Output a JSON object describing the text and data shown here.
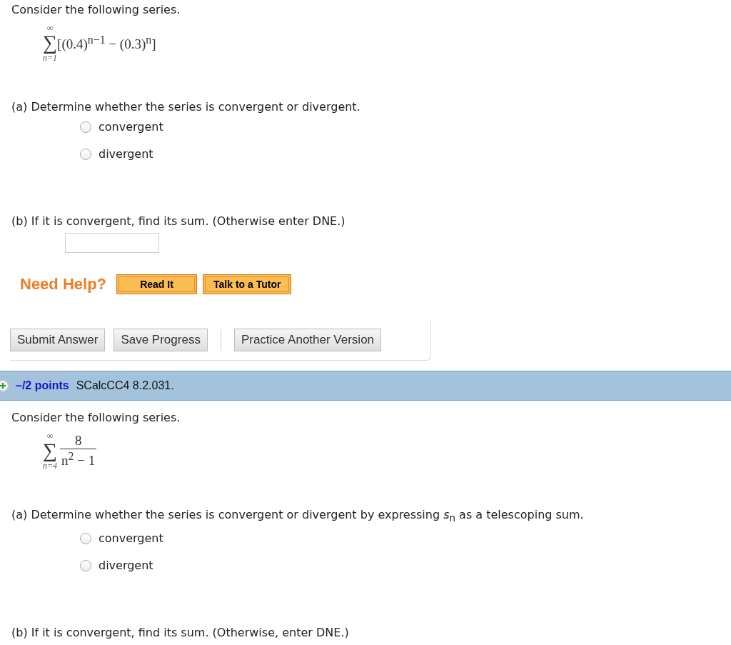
{
  "questions": [
    {
      "intro": "Consider the following series.",
      "formula": {
        "kind": "bracket",
        "upper": "∞",
        "sigma": "∑",
        "lower": "n=1",
        "body": "[(0.4)$^{n−1}$ − (0.3)$^{n}$]"
      },
      "part_a": {
        "prompt": "(a) Determine whether the series is convergent or divergent.",
        "options": [
          {
            "label": "convergent",
            "selected": false
          },
          {
            "label": "divergent",
            "selected": false
          }
        ]
      },
      "part_b": {
        "prompt": "(b) If it is convergent, find its sum. (Otherwise enter DNE.)",
        "has_field": true
      },
      "help": {
        "label": "Need Help?",
        "buttons": [
          "Read It",
          "Talk to a Tutor"
        ]
      },
      "actions": [
        "Submit Answer",
        "Save Progress",
        "Practice Another Version"
      ]
    },
    {
      "header": {
        "points": "–/2 points",
        "code": "SCalcCC4 8.2.031."
      },
      "intro": "Consider the following series.",
      "formula": {
        "kind": "fraction",
        "upper": "∞",
        "sigma": "∑",
        "lower": "n=4",
        "numerator": "8",
        "denominator": "n$^{2}$ − 1"
      },
      "part_a": {
        "prompt": "(a) Determine whether the series is convergent or divergent by expressing *s*$_{n}$ as a telescoping sum.",
        "options": [
          {
            "label": "convergent",
            "selected": false
          },
          {
            "label": "divergent",
            "selected": false
          }
        ]
      },
      "part_b": {
        "prompt": "(b) If it is convergent, find its sum. (Otherwise, enter DNE.)",
        "has_field": false
      }
    }
  ]
}
